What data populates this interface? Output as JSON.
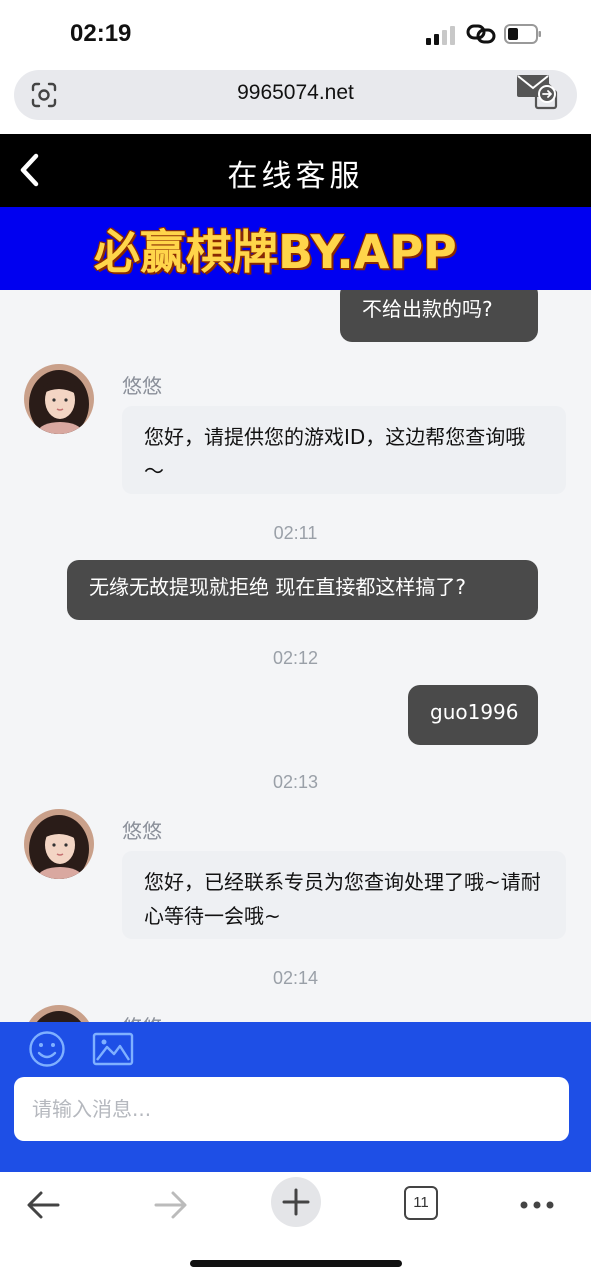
{
  "status_bar": {
    "time": "02:19"
  },
  "browser": {
    "url": "9965074.net",
    "tab_count": "11"
  },
  "header": {
    "title": "在线客服"
  },
  "banner": {
    "text": "必赢棋牌BY.APP"
  },
  "chat": {
    "agent_name": "悠悠",
    "messages": [
      {
        "type": "out",
        "text": "不给出款的吗?"
      },
      {
        "type": "in",
        "sender": "悠悠",
        "text": "您好，请提供您的游戏ID，这边帮您查询哦～"
      },
      {
        "type": "time",
        "text": "02:11"
      },
      {
        "type": "out",
        "text": "无缘无故提现就拒绝 现在直接都这样搞了?"
      },
      {
        "type": "time",
        "text": "02:12"
      },
      {
        "type": "out",
        "text": "guo1996"
      },
      {
        "type": "time",
        "text": "02:13"
      },
      {
        "type": "in",
        "sender": "悠悠",
        "text": "您好，已经联系专员为您查询处理了哦~请耐心等待一会哦~"
      },
      {
        "type": "time",
        "text": "02:14"
      },
      {
        "type": "in_partial",
        "sender": "悠悠"
      }
    ]
  },
  "input": {
    "placeholder": "请输入消息..."
  },
  "colors": {
    "header_bg": "#000000",
    "banner_bg": "#0000f0",
    "input_panel_bg": "#1e4fe6",
    "outgoing_bubble": "#4a4a4a",
    "incoming_bubble": "#eef0f3"
  }
}
